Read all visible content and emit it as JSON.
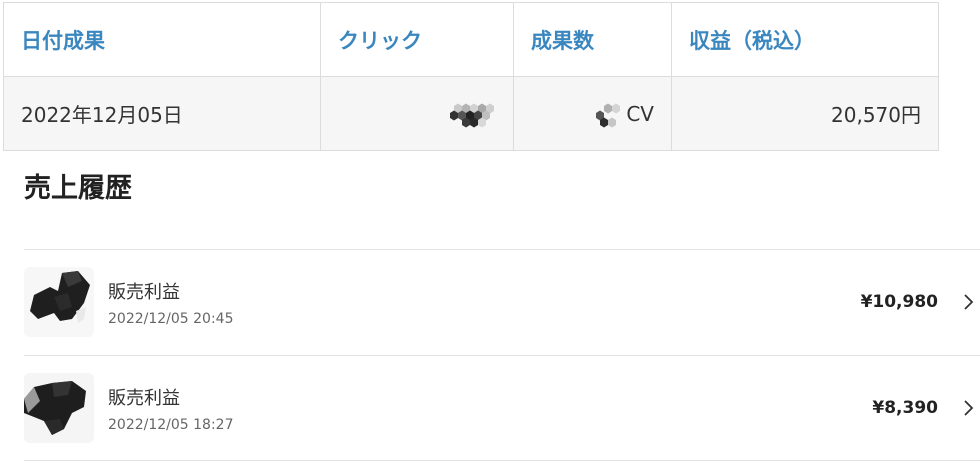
{
  "table": {
    "headers": {
      "date": "日付成果",
      "click": "クリック",
      "conversions": "成果数",
      "revenue": "収益（税込）"
    },
    "row": {
      "date": "2022年12月05日",
      "click_icon": "redacted-hex-icon",
      "cv_icon": "redacted-hex-icon",
      "cv_unit": "CV",
      "revenue": "20,570円"
    }
  },
  "sales_history": {
    "title": "売上履歴",
    "items": [
      {
        "thumbnail": "product-image",
        "title": "販売利益",
        "date": "2022/12/05 20:45",
        "amount": "¥10,980",
        "icon": "chevron-right-icon"
      },
      {
        "thumbnail": "product-image",
        "title": "販売利益",
        "date": "2022/12/05 18:27",
        "amount": "¥8,390",
        "icon": "chevron-right-icon"
      }
    ]
  },
  "colors": {
    "header_text": "#3a87c0",
    "row_background": "#f6f6f6",
    "border": "#dcdcdc",
    "text": "#333333"
  }
}
